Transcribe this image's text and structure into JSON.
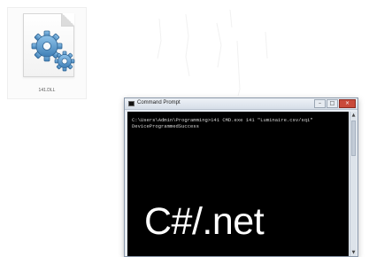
{
  "file": {
    "name": "141.DLL",
    "icon": "gears-icon"
  },
  "cmd_window": {
    "title": "Command Prompt",
    "buttons": {
      "minimize": "–",
      "maximize": "□",
      "close": "×"
    },
    "console_lines": [
      "C:\\Users\\Admin\\Programming>141 CMD.exe 141 \"Luminaire.csv/sqi\"",
      "DeviceProgrammedSuccess"
    ]
  },
  "overlay": {
    "caption": "C#/.net"
  },
  "colors": {
    "console_background": "#000000",
    "console_text": "#d4d4d4",
    "caption_text": "#ffffff",
    "gear_blue": "#4a90c8"
  }
}
